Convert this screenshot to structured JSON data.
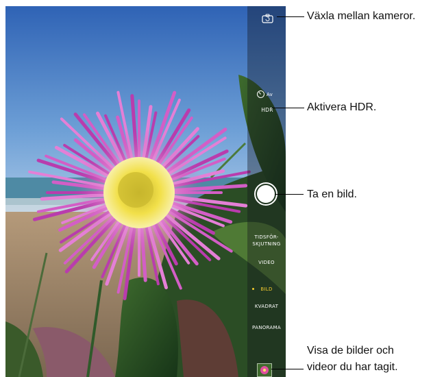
{
  "camera": {
    "timer_label": "Av",
    "hdr_label": "HDR",
    "modes": [
      {
        "label_line1": "TIDSFÖR-",
        "label_line2": "SKJUTNING"
      },
      {
        "label": "VIDEO"
      },
      {
        "label": "BILD",
        "selected": true
      },
      {
        "label": "KVADRAT"
      },
      {
        "label": "PANORAMA"
      }
    ],
    "accent_color": "#f5cc2e",
    "icons": [
      "switch-camera-icon",
      "timer-icon",
      "shutter-button",
      "photo-thumbnail"
    ]
  },
  "callouts": {
    "switch_camera": "Växla mellan kameror.",
    "hdr": "Aktivera HDR.",
    "shutter": "Ta en bild.",
    "view_line1": "Visa de bilder och",
    "view_line2": "videor du har tagit."
  }
}
